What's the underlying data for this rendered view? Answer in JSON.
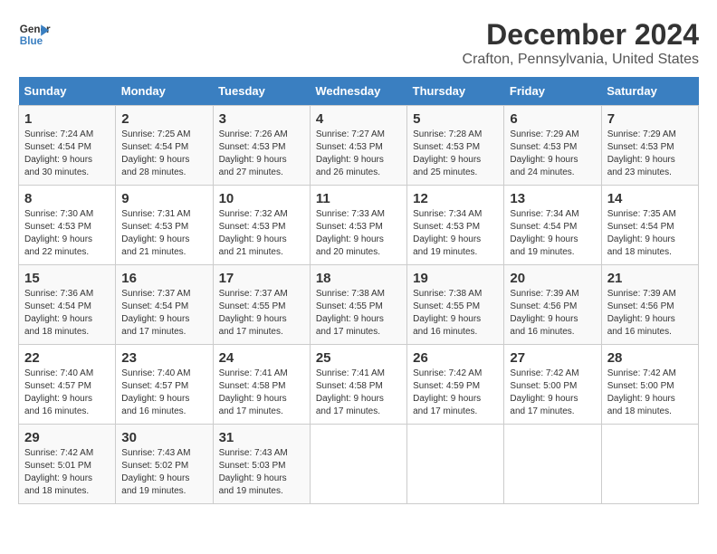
{
  "header": {
    "logo_line1": "General",
    "logo_line2": "Blue",
    "title": "December 2024",
    "subtitle": "Crafton, Pennsylvania, United States"
  },
  "weekdays": [
    "Sunday",
    "Monday",
    "Tuesday",
    "Wednesday",
    "Thursday",
    "Friday",
    "Saturday"
  ],
  "weeks": [
    [
      {
        "day": "1",
        "sunrise": "7:24 AM",
        "sunset": "4:54 PM",
        "daylight": "9 hours and 30 minutes."
      },
      {
        "day": "2",
        "sunrise": "7:25 AM",
        "sunset": "4:54 PM",
        "daylight": "9 hours and 28 minutes."
      },
      {
        "day": "3",
        "sunrise": "7:26 AM",
        "sunset": "4:53 PM",
        "daylight": "9 hours and 27 minutes."
      },
      {
        "day": "4",
        "sunrise": "7:27 AM",
        "sunset": "4:53 PM",
        "daylight": "9 hours and 26 minutes."
      },
      {
        "day": "5",
        "sunrise": "7:28 AM",
        "sunset": "4:53 PM",
        "daylight": "9 hours and 25 minutes."
      },
      {
        "day": "6",
        "sunrise": "7:29 AM",
        "sunset": "4:53 PM",
        "daylight": "9 hours and 24 minutes."
      },
      {
        "day": "7",
        "sunrise": "7:29 AM",
        "sunset": "4:53 PM",
        "daylight": "9 hours and 23 minutes."
      }
    ],
    [
      {
        "day": "8",
        "sunrise": "7:30 AM",
        "sunset": "4:53 PM",
        "daylight": "9 hours and 22 minutes."
      },
      {
        "day": "9",
        "sunrise": "7:31 AM",
        "sunset": "4:53 PM",
        "daylight": "9 hours and 21 minutes."
      },
      {
        "day": "10",
        "sunrise": "7:32 AM",
        "sunset": "4:53 PM",
        "daylight": "9 hours and 21 minutes."
      },
      {
        "day": "11",
        "sunrise": "7:33 AM",
        "sunset": "4:53 PM",
        "daylight": "9 hours and 20 minutes."
      },
      {
        "day": "12",
        "sunrise": "7:34 AM",
        "sunset": "4:53 PM",
        "daylight": "9 hours and 19 minutes."
      },
      {
        "day": "13",
        "sunrise": "7:34 AM",
        "sunset": "4:54 PM",
        "daylight": "9 hours and 19 minutes."
      },
      {
        "day": "14",
        "sunrise": "7:35 AM",
        "sunset": "4:54 PM",
        "daylight": "9 hours and 18 minutes."
      }
    ],
    [
      {
        "day": "15",
        "sunrise": "7:36 AM",
        "sunset": "4:54 PM",
        "daylight": "9 hours and 18 minutes."
      },
      {
        "day": "16",
        "sunrise": "7:37 AM",
        "sunset": "4:54 PM",
        "daylight": "9 hours and 17 minutes."
      },
      {
        "day": "17",
        "sunrise": "7:37 AM",
        "sunset": "4:55 PM",
        "daylight": "9 hours and 17 minutes."
      },
      {
        "day": "18",
        "sunrise": "7:38 AM",
        "sunset": "4:55 PM",
        "daylight": "9 hours and 17 minutes."
      },
      {
        "day": "19",
        "sunrise": "7:38 AM",
        "sunset": "4:55 PM",
        "daylight": "9 hours and 16 minutes."
      },
      {
        "day": "20",
        "sunrise": "7:39 AM",
        "sunset": "4:56 PM",
        "daylight": "9 hours and 16 minutes."
      },
      {
        "day": "21",
        "sunrise": "7:39 AM",
        "sunset": "4:56 PM",
        "daylight": "9 hours and 16 minutes."
      }
    ],
    [
      {
        "day": "22",
        "sunrise": "7:40 AM",
        "sunset": "4:57 PM",
        "daylight": "9 hours and 16 minutes."
      },
      {
        "day": "23",
        "sunrise": "7:40 AM",
        "sunset": "4:57 PM",
        "daylight": "9 hours and 16 minutes."
      },
      {
        "day": "24",
        "sunrise": "7:41 AM",
        "sunset": "4:58 PM",
        "daylight": "9 hours and 17 minutes."
      },
      {
        "day": "25",
        "sunrise": "7:41 AM",
        "sunset": "4:58 PM",
        "daylight": "9 hours and 17 minutes."
      },
      {
        "day": "26",
        "sunrise": "7:42 AM",
        "sunset": "4:59 PM",
        "daylight": "9 hours and 17 minutes."
      },
      {
        "day": "27",
        "sunrise": "7:42 AM",
        "sunset": "5:00 PM",
        "daylight": "9 hours and 17 minutes."
      },
      {
        "day": "28",
        "sunrise": "7:42 AM",
        "sunset": "5:00 PM",
        "daylight": "9 hours and 18 minutes."
      }
    ],
    [
      {
        "day": "29",
        "sunrise": "7:42 AM",
        "sunset": "5:01 PM",
        "daylight": "9 hours and 18 minutes."
      },
      {
        "day": "30",
        "sunrise": "7:43 AM",
        "sunset": "5:02 PM",
        "daylight": "9 hours and 19 minutes."
      },
      {
        "day": "31",
        "sunrise": "7:43 AM",
        "sunset": "5:03 PM",
        "daylight": "9 hours and 19 minutes."
      },
      null,
      null,
      null,
      null
    ]
  ]
}
